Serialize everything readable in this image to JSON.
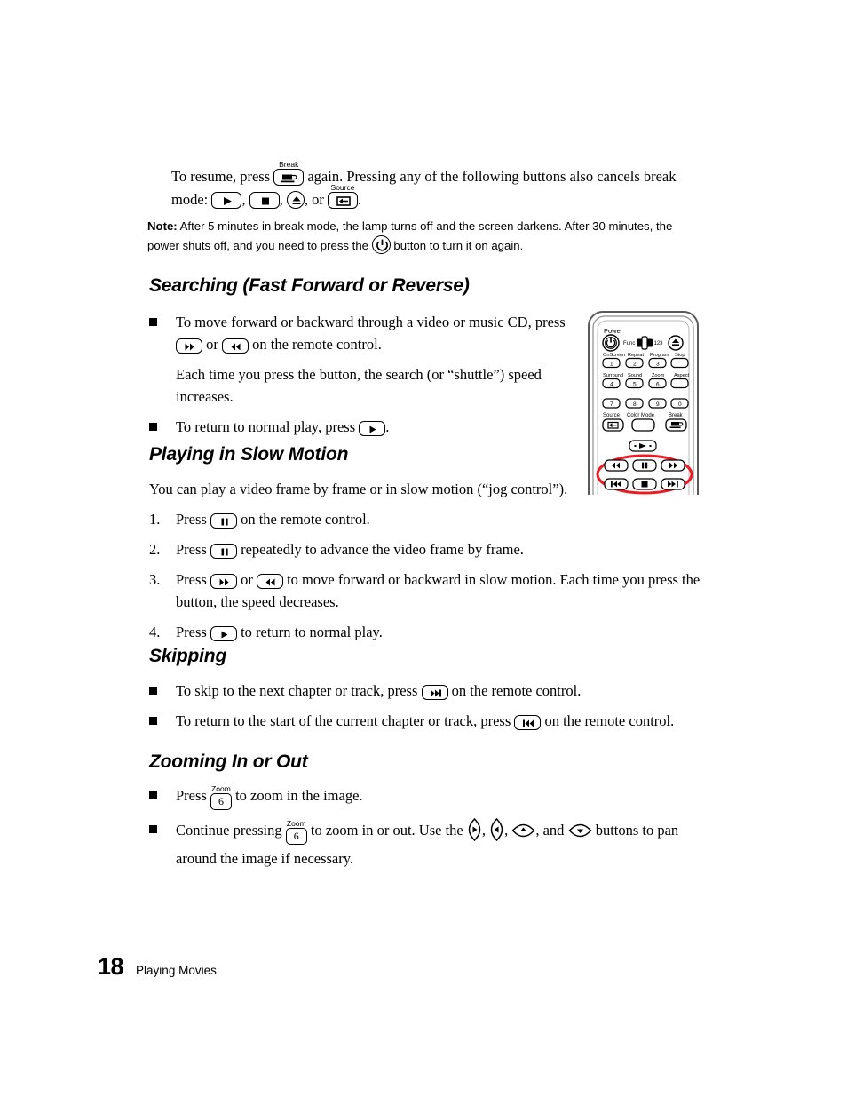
{
  "page": {
    "folio": "18",
    "footer_title": "Playing Movies"
  },
  "intro": {
    "part1": "To resume, press",
    "break_label": "Break",
    "part2": "again. Pressing any of the following buttons also cancels break mode:",
    "comma1": ",",
    "comma2": ",",
    "or": ", or",
    "source_label": "Source",
    "period": "."
  },
  "note": {
    "label": "Note:",
    "text1": "After 5 minutes in break mode, the lamp turns off and the screen darkens. After 30 minutes, the power shuts off, and you need to press the",
    "text2": "button to turn it on again."
  },
  "sections": {
    "searching": {
      "heading": "Searching (Fast Forward or Reverse)",
      "bullet1_a": "To move forward or backward through a video or music CD, press",
      "bullet1_or": "or",
      "bullet1_b": "on the remote control.",
      "para": "Each time you press the button, the search (or “shuttle”) speed increases.",
      "bullet2_a": "To return to normal play, press",
      "bullet2_b": "."
    },
    "slow_motion": {
      "heading": "Playing in Slow Motion",
      "intro": "You can play a video frame by frame or in slow motion (“jog control”).",
      "steps": [
        {
          "number": "1.",
          "pre": "Press",
          "post": "on the remote control."
        },
        {
          "number": "2.",
          "pre": "Press",
          "post": "repeatedly to advance the video frame by frame."
        },
        {
          "number": "3.",
          "pre": "Press",
          "mid": "or",
          "post": "to move forward or backward in slow motion. Each time you press the button, the speed decreases."
        },
        {
          "number": "4.",
          "pre": "Press",
          "post": "to return to normal play."
        }
      ]
    },
    "skipping": {
      "heading": "Skipping",
      "bullet1_a": "To skip to the next chapter or track, press",
      "bullet1_b": "on the remote control.",
      "bullet2_a": "To return to the start of the current chapter or track, press",
      "bullet2_b": "on the remote control."
    },
    "zooming": {
      "heading": "Zooming In or Out",
      "zoom_label": "Zoom",
      "key6": "6",
      "bullet1_a": "Press",
      "bullet1_b": "to zoom in the image.",
      "bullet2_a": "Continue pressing",
      "bullet2_b": "to zoom in or out. Use the",
      "bullet2_c": ",",
      "bullet2_d": ",",
      "bullet2_e": ", and",
      "bullet2_f": "buttons to pan around the image if necessary."
    }
  },
  "remote": {
    "power_label": "Power",
    "func_label": "Func",
    "func_mode": "123",
    "row_labels_1": [
      "OnScreen",
      "Repeat",
      "Program",
      "Stop"
    ],
    "row_keys_1": [
      "1",
      "2",
      "3",
      ""
    ],
    "row_labels_2": [
      "Surround",
      "Sound",
      "Zoom",
      "Aspect"
    ],
    "row_keys_2": [
      "4",
      "5",
      "6",
      ""
    ],
    "row_keys_3": [
      "7",
      "8",
      "9",
      "0"
    ],
    "row_labels_4": [
      "Source",
      "Color Mode",
      "Break"
    ],
    "highlight_color": "#ED1C24"
  }
}
